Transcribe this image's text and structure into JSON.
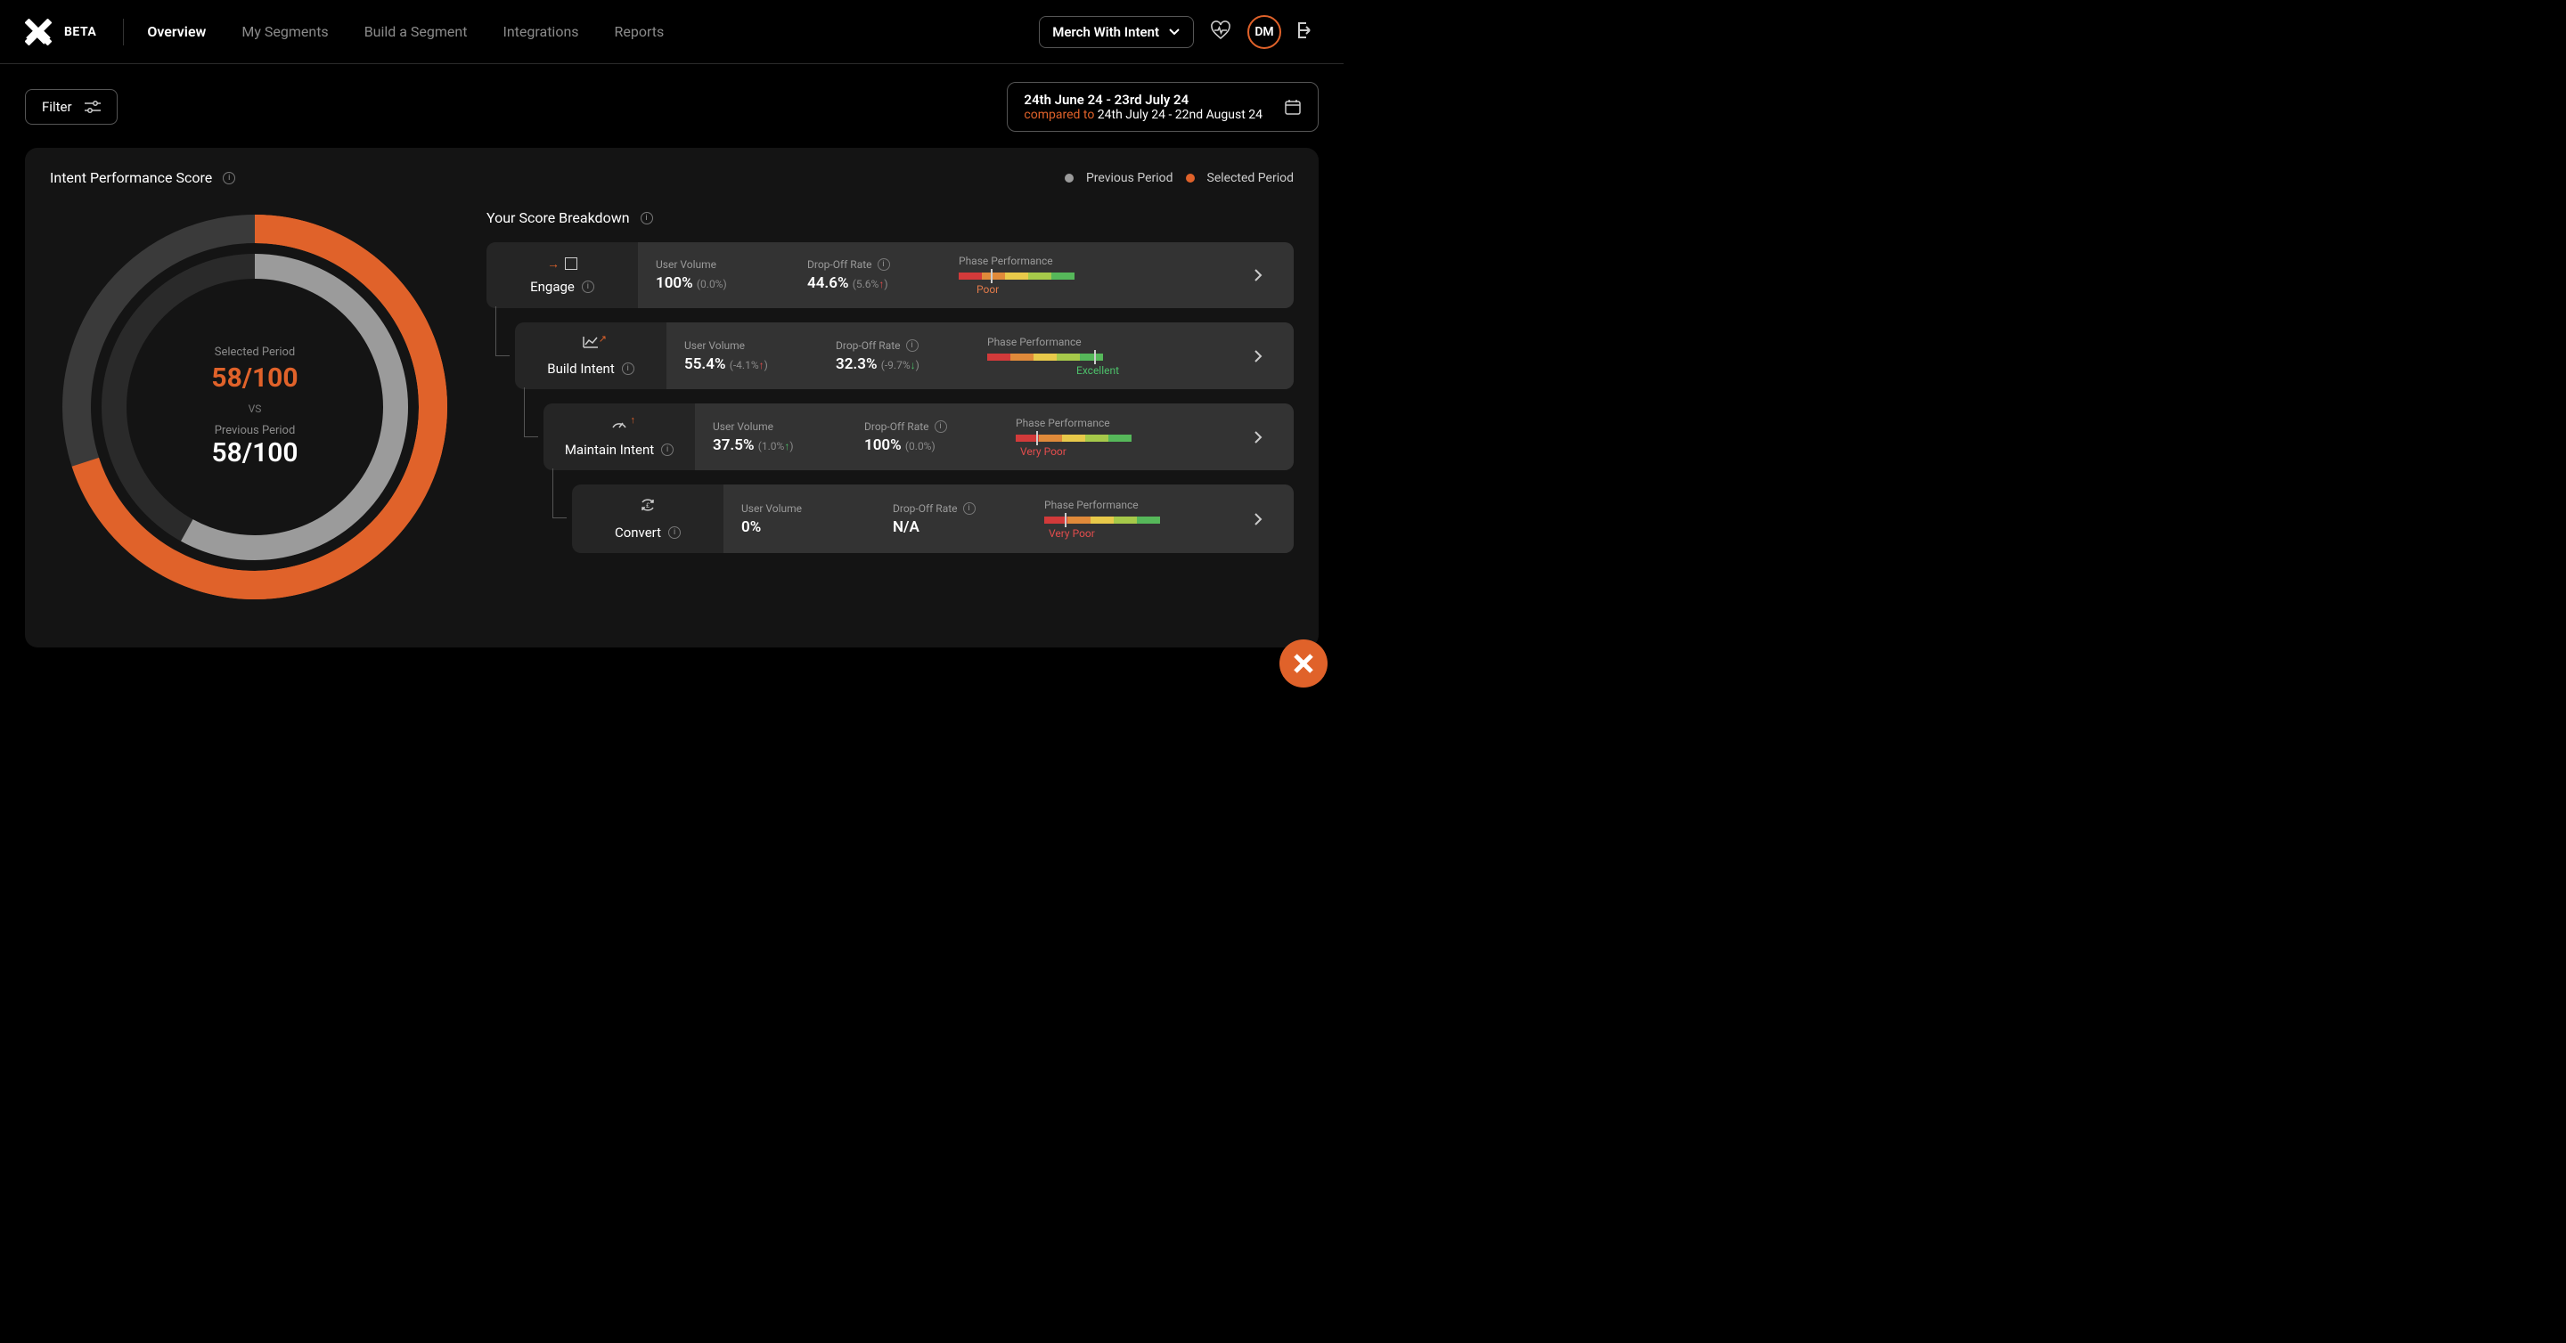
{
  "header": {
    "beta": "BETA",
    "nav": {
      "overview": "Overview",
      "my_segments": "My Segments",
      "build_segment": "Build a Segment",
      "integrations": "Integrations",
      "reports": "Reports"
    },
    "workspace": "Merch With Intent",
    "avatar": "DM"
  },
  "toolbar": {
    "filter": "Filter",
    "date_range": {
      "primary": "24th June 24 - 23rd July 24",
      "compared_prefix": "compared to",
      "compared_range": "24th July 24 - 22nd August 24"
    }
  },
  "card": {
    "title": "Intent Performance Score",
    "legend_prev": "Previous Period",
    "legend_sel": "Selected Period",
    "gauge": {
      "selected_label": "Selected Period",
      "selected_score": "58/100",
      "vs": "VS",
      "previous_label": "Previous Period",
      "previous_score": "58/100"
    },
    "breakdown_title": "Your Score Breakdown",
    "metrics_labels": {
      "user_volume": "User Volume",
      "drop_off": "Drop-Off Rate",
      "phase_perf": "Phase Performance"
    },
    "phases": [
      {
        "name": "Engage",
        "user_volume": "100%",
        "uv_delta": "(0.0%)",
        "drop_off": "44.6%",
        "do_delta": "(5.6%",
        "do_dir": "up",
        "rating": "Poor",
        "marker_pct": 28
      },
      {
        "name": "Build Intent",
        "user_volume": "55.4%",
        "uv_delta": "(-4.1%",
        "uv_dir": "up",
        "drop_off": "32.3%",
        "do_delta": "(-9.7%",
        "do_dir": "down",
        "rating": "Excellent",
        "marker_pct": 92
      },
      {
        "name": "Maintain Intent",
        "user_volume": "37.5%",
        "uv_delta": "(1.0%",
        "uv_dir": "down-green",
        "drop_off": "100%",
        "do_delta": "(0.0%)",
        "rating": "Very Poor",
        "marker_pct": 18
      },
      {
        "name": "Convert",
        "user_volume": "0%",
        "uv_delta": "",
        "drop_off": "N/A",
        "do_delta": "",
        "rating": "Very Poor",
        "marker_pct": 18
      }
    ]
  },
  "chart_data": {
    "type": "pie",
    "title": "Intent Performance Score",
    "series": [
      {
        "name": "Selected Period",
        "values": [
          58
        ],
        "max": 100,
        "color": "#e0622a"
      },
      {
        "name": "Previous Period",
        "values": [
          58
        ],
        "max": 100,
        "color": "#9b9b9b"
      }
    ]
  }
}
